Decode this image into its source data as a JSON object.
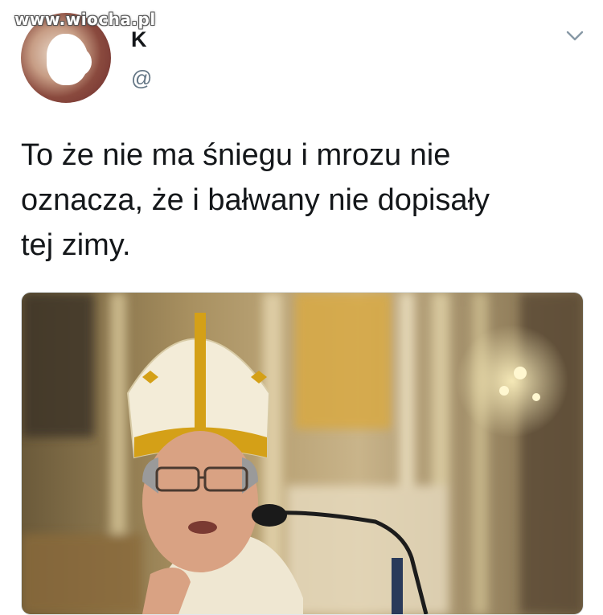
{
  "watermark": "www.wiocha.pl",
  "author": {
    "display_name": "K",
    "handle": "@"
  },
  "icons": {
    "menu": "chevron-down-icon"
  },
  "tweet": {
    "text_lines": [
      "To że nie ma śniegu i mrozu nie",
      "oznacza, że i bałwany nie dopisały",
      "tej zimy."
    ]
  },
  "colors": {
    "text": "#14171a",
    "secondary_text": "#657786",
    "border": "#e1e8ed",
    "gold": "#d4a017"
  }
}
